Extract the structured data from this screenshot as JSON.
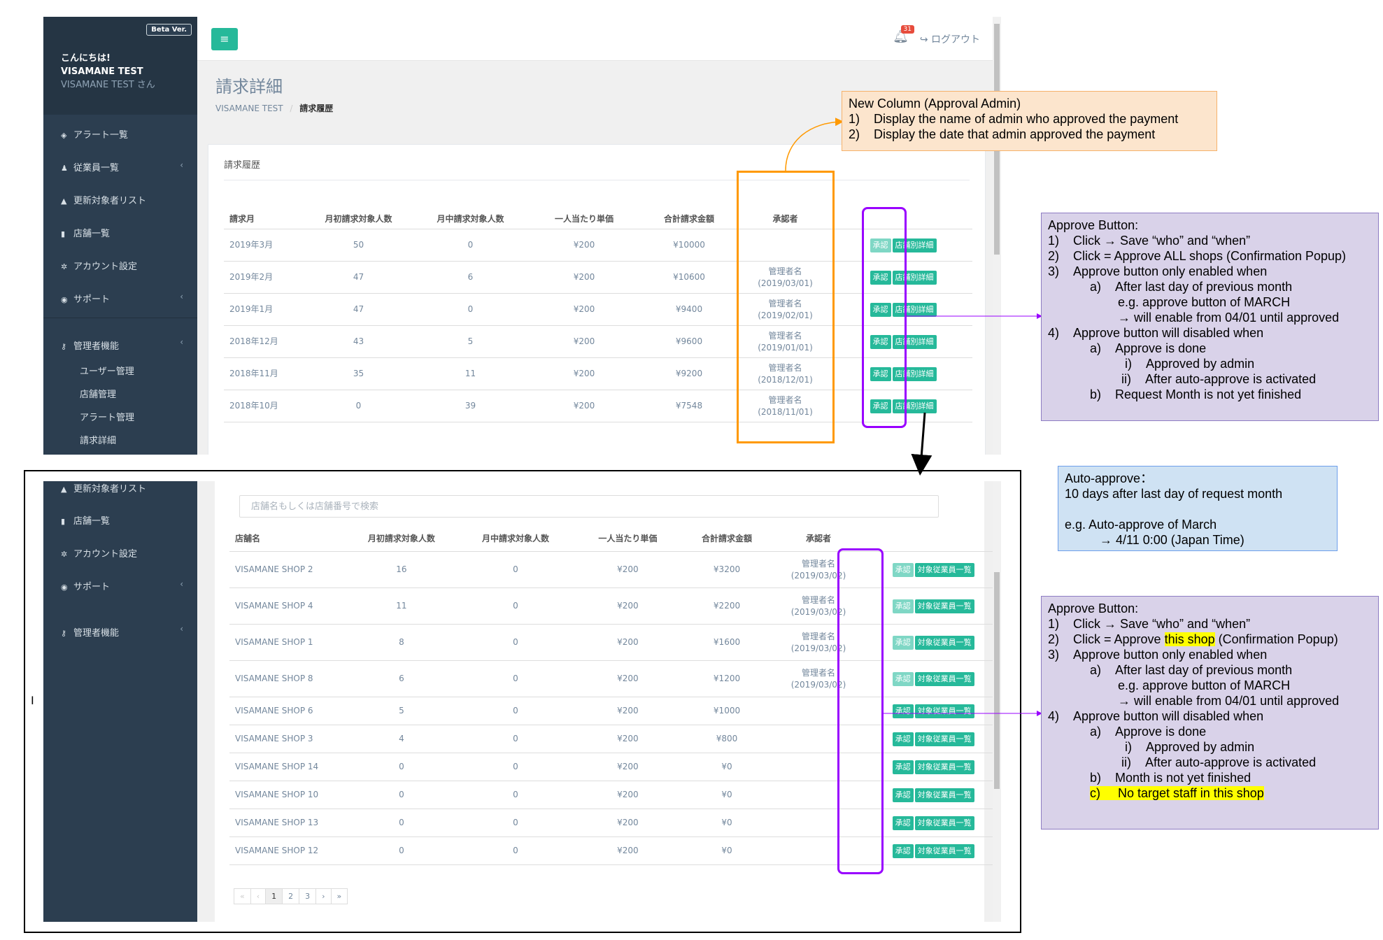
{
  "top": {
    "sidebar": {
      "beta": "Beta Ver.",
      "greeting": "こんにちは!",
      "user": "VISAMANE TEST",
      "user_sub": "VISAMANE TEST さん",
      "items": [
        {
          "label": "アラート一覧",
          "icon": "dashboard-icon"
        },
        {
          "label": "従業員一覧",
          "icon": "users-icon"
        },
        {
          "label": "更新対象者リスト",
          "icon": "bell-icon"
        },
        {
          "label": "店舗一覧",
          "icon": "book-icon"
        },
        {
          "label": "アカウント設定",
          "icon": "gear-icon"
        },
        {
          "label": "サポート",
          "icon": "lifebuoy-icon"
        },
        {
          "label": "管理者機能",
          "icon": "key-icon"
        }
      ],
      "sub_items": [
        "ユーザー管理",
        "店舗管理",
        "アラート管理",
        "請求詳細"
      ]
    },
    "header": {
      "notif_count": "31",
      "logout": "ログアウト"
    },
    "page_title": "請求詳細",
    "breadcrumb": {
      "root": "VISAMANE TEST",
      "sep": "/",
      "current": "請求履歴"
    },
    "panel_title": "請求履歴",
    "columns": [
      "請求月",
      "月初請求対象人数",
      "月中請求対象人数",
      "一人当たり単価",
      "合計請求金額",
      "承認者"
    ],
    "rows": [
      {
        "month": "2019年3月",
        "start": "50",
        "mid": "0",
        "unit": "¥200",
        "total": "¥10000",
        "approver": "",
        "date": ""
      },
      {
        "month": "2019年2月",
        "start": "47",
        "mid": "6",
        "unit": "¥200",
        "total": "¥10600",
        "approver": "管理者名",
        "date": "(2019/03/01)"
      },
      {
        "month": "2019年1月",
        "start": "47",
        "mid": "0",
        "unit": "¥200",
        "total": "¥9400",
        "approver": "管理者名",
        "date": "(2019/02/01)"
      },
      {
        "month": "2018年12月",
        "start": "43",
        "mid": "5",
        "unit": "¥200",
        "total": "¥9600",
        "approver": "管理者名",
        "date": "(2019/01/01)"
      },
      {
        "month": "2018年11月",
        "start": "35",
        "mid": "11",
        "unit": "¥200",
        "total": "¥9200",
        "approver": "管理者名",
        "date": "(2018/12/01)"
      },
      {
        "month": "2018年10月",
        "start": "0",
        "mid": "39",
        "unit": "¥200",
        "total": "¥7548",
        "approver": "管理者名",
        "date": "(2018/11/01)"
      }
    ],
    "approve_label": "承認",
    "detail_label": "店舗別詳細"
  },
  "bottom": {
    "sidebar_items": [
      {
        "label": "更新対象者リスト",
        "icon": "bell-icon"
      },
      {
        "label": "店舗一覧",
        "icon": "book-icon"
      },
      {
        "label": "アカウント設定",
        "icon": "gear-icon"
      },
      {
        "label": "サポート",
        "icon": "lifebuoy-icon"
      },
      {
        "label": "管理者機能",
        "icon": "key-icon"
      }
    ],
    "search_placeholder": "店舗名もしくは店舗番号で検索",
    "columns": [
      "店舗名",
      "月初請求対象人数",
      "月中請求対象人数",
      "一人当たり単価",
      "合計請求金額",
      "承認者"
    ],
    "rows": [
      {
        "shop": "VISAMANE SHOP 2",
        "start": "16",
        "mid": "0",
        "unit": "¥200",
        "total": "¥3200",
        "approver": "管理者名",
        "date": "(2019/03/02)"
      },
      {
        "shop": "VISAMANE SHOP 4",
        "start": "11",
        "mid": "0",
        "unit": "¥200",
        "total": "¥2200",
        "approver": "管理者名",
        "date": "(2019/03/02)"
      },
      {
        "shop": "VISAMANE SHOP 1",
        "start": "8",
        "mid": "0",
        "unit": "¥200",
        "total": "¥1600",
        "approver": "管理者名",
        "date": "(2019/03/02)"
      },
      {
        "shop": "VISAMANE SHOP 8",
        "start": "6",
        "mid": "0",
        "unit": "¥200",
        "total": "¥1200",
        "approver": "管理者名",
        "date": "(2019/03/02)"
      },
      {
        "shop": "VISAMANE SHOP 6",
        "start": "5",
        "mid": "0",
        "unit": "¥200",
        "total": "¥1000",
        "approver": "",
        "date": ""
      },
      {
        "shop": "VISAMANE SHOP 3",
        "start": "4",
        "mid": "0",
        "unit": "¥200",
        "total": "¥800",
        "approver": "",
        "date": ""
      },
      {
        "shop": "VISAMANE SHOP 14",
        "start": "0",
        "mid": "0",
        "unit": "¥200",
        "total": "¥0",
        "approver": "",
        "date": ""
      },
      {
        "shop": "VISAMANE SHOP 10",
        "start": "0",
        "mid": "0",
        "unit": "¥200",
        "total": "¥0",
        "approver": "",
        "date": ""
      },
      {
        "shop": "VISAMANE SHOP 13",
        "start": "0",
        "mid": "0",
        "unit": "¥200",
        "total": "¥0",
        "approver": "",
        "date": ""
      },
      {
        "shop": "VISAMANE SHOP 12",
        "start": "0",
        "mid": "0",
        "unit": "¥200",
        "total": "¥0",
        "approver": "",
        "date": ""
      }
    ],
    "approve_label": "承認",
    "staff_label": "対象従業員一覧",
    "pager": [
      "«",
      "‹",
      "1",
      "2",
      "3",
      "›",
      "»"
    ]
  },
  "notes": {
    "new_column": [
      "New Column (Approval Admin)",
      "1)    Display the name of admin who approved the payment",
      "2)    Display the date that admin approved the payment"
    ],
    "approve_month": [
      "Approve Button:",
      "1)    Click → Save “who” and “when”",
      "2)    Click = Approve ALL shops (Confirmation Popup)",
      "3)    Approve button only enabled when",
      "            a)    After last day of previous month",
      "                    e.g. approve button of MARCH",
      "                    → will enable from 04/01 until approved",
      "4)    Approve button will disabled when",
      "            a)    Approve is done",
      "                      i)    Approved by admin",
      "                     ii)    After auto-approve is activated",
      "            b)    Request Month is not yet finished"
    ],
    "auto_approve": [
      "Auto-approve：",
      "10 days after last day of request month",
      "",
      "e.g. Auto-approve of March",
      "          → 4/11 0:00 (Japan Time)"
    ],
    "approve_shop": {
      "title": "Approve Button:",
      "l1": "1)    Click → Save “who” and “when”",
      "l2_pre": "2)    Click = Approve ",
      "l2_hl": "this shop",
      "l2_post": " (Confirmation Popup)",
      "l3": "3)    Approve button only enabled when",
      "l4": "            a)    After last day of previous month",
      "l5": "                    e.g. approve button of MARCH",
      "l6": "                    → will enable from 04/01 until approved",
      "l7": "4)    Approve button will disabled when",
      "l8": "            a)    Approve is done",
      "l9": "                      i)    Approved by admin",
      "l10": "                     ii)    After auto-approve is activated",
      "l11": "            b)    Month is not yet finished",
      "l12_indent": "            ",
      "l12": "c)     No target staff in this shop"
    },
    "cursor_glyph": "I"
  },
  "colors": {
    "accent": "#26b99a",
    "sidebar": "#2c3e50",
    "orange": "#ff9900",
    "purple": "#9900ff",
    "highlight": "#ffff00"
  }
}
